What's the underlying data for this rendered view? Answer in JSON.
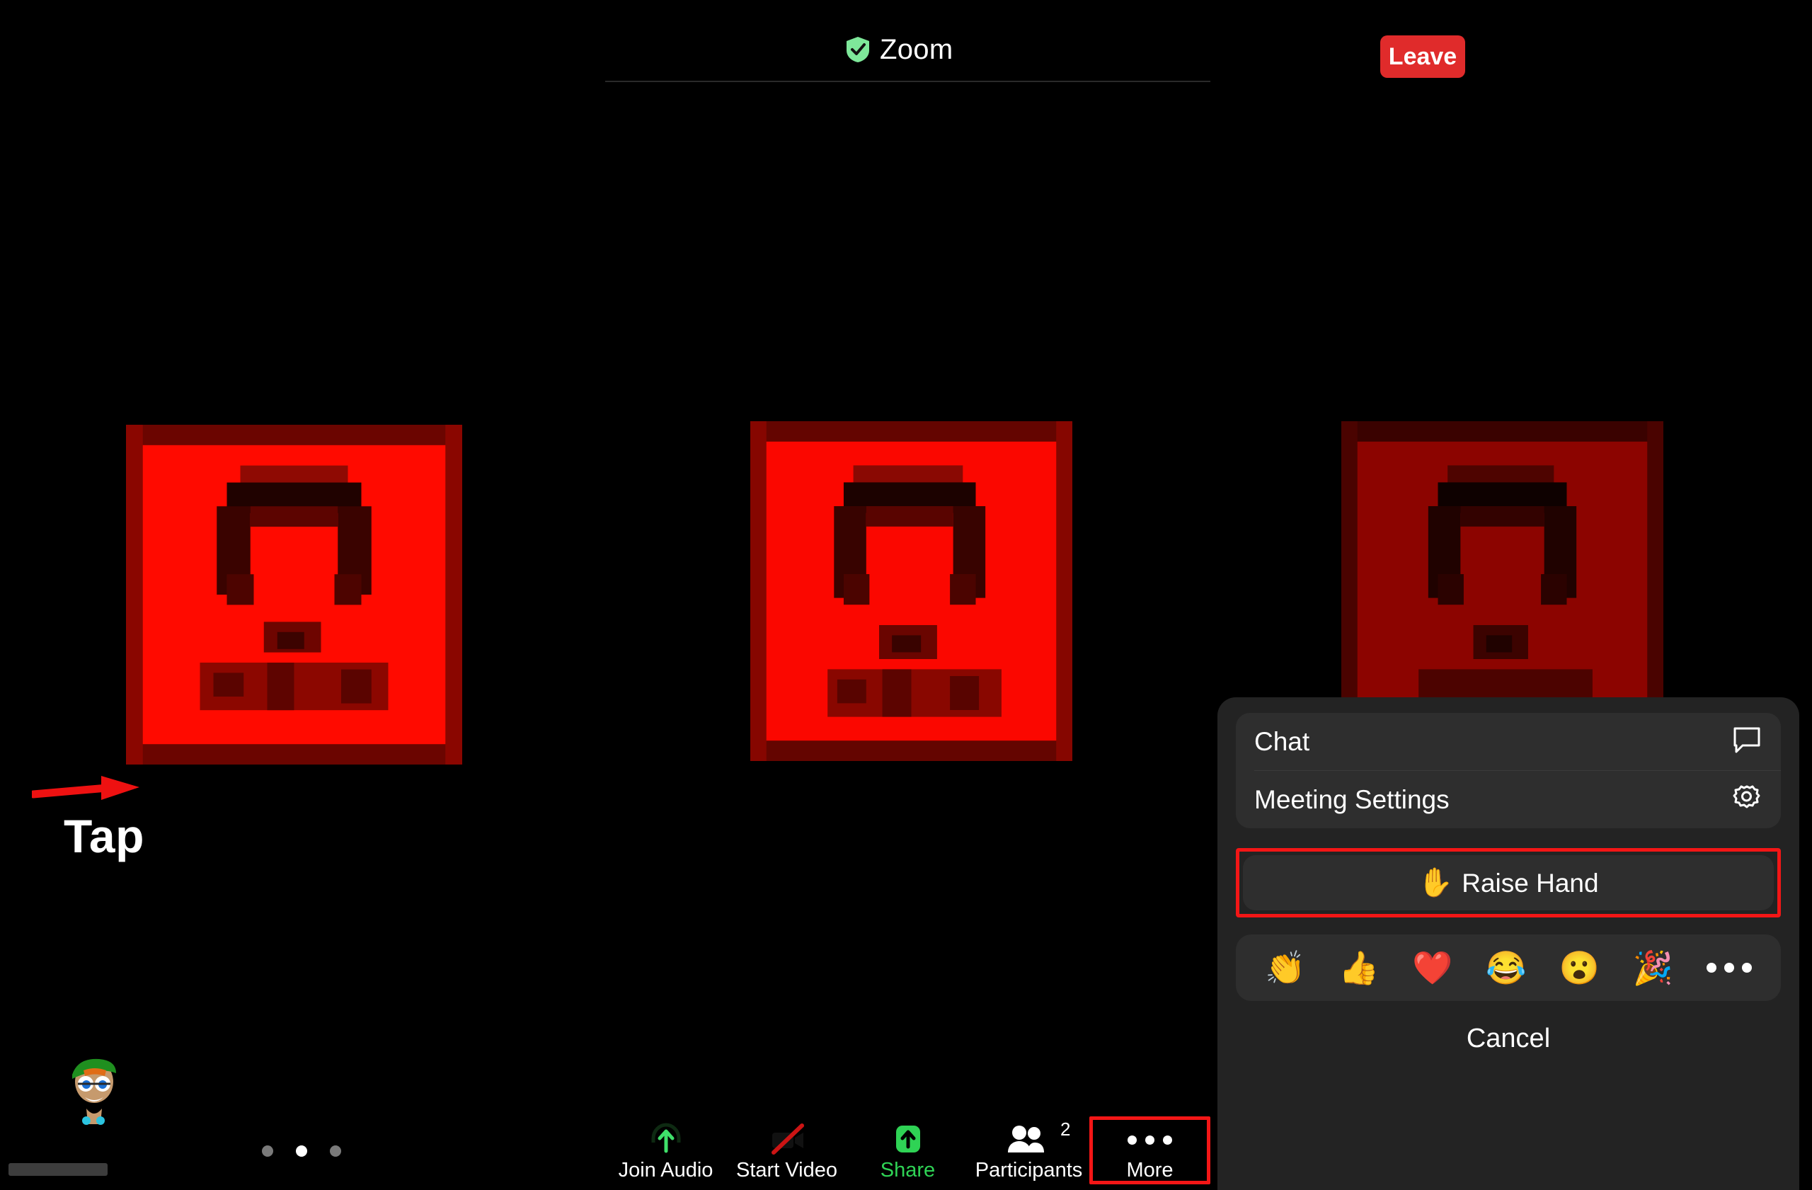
{
  "meeting": {
    "app_name": "Zoom",
    "security_icon": "shield-check-icon",
    "leave_label": "Leave"
  },
  "annotation": {
    "tap_label": "Tap",
    "arrow_icon": "red-arrow-right-icon",
    "more_highlight_color": "#f31616",
    "raise_hand_highlight_color": "#f31616"
  },
  "tiles": [
    {
      "name": "participant-video-tile-1",
      "state": "pixelated-red"
    },
    {
      "name": "participant-video-tile-2",
      "state": "pixelated-red"
    },
    {
      "name": "participant-video-tile-3",
      "state": "pixelated-red-dim"
    }
  ],
  "page_dots": {
    "count": 3,
    "active_index": 1
  },
  "toolbar": {
    "items": [
      {
        "label": "Join Audio",
        "icon": "headphone-up-arrow-icon",
        "accent": "#3fe06a",
        "highlighted": false,
        "badge": ""
      },
      {
        "label": "Start Video",
        "icon": "camera-off-icon",
        "accent": "#ffffff",
        "highlighted": false,
        "badge": ""
      },
      {
        "label": "Share",
        "icon": "share-up-arrow-icon",
        "accent": "#2fd355",
        "highlighted": false,
        "badge": ""
      },
      {
        "label": "Participants",
        "icon": "participants-icon",
        "accent": "#ffffff",
        "highlighted": false,
        "badge": "2"
      },
      {
        "label": "More",
        "icon": "ellipsis-icon",
        "accent": "#ffffff",
        "highlighted": true,
        "badge": ""
      }
    ]
  },
  "sheet": {
    "rows": [
      {
        "label": "Chat",
        "icon": "chat-bubble-icon"
      },
      {
        "label": "Meeting Settings",
        "icon": "gear-icon"
      }
    ],
    "raise_hand": {
      "label": "Raise Hand",
      "emoji": "✋",
      "icon": "raised-hand-icon"
    },
    "reactions": [
      {
        "name": "clap-emoji",
        "glyph": "👏"
      },
      {
        "name": "thumbs-up-emoji",
        "glyph": "👍"
      },
      {
        "name": "heart-emoji",
        "glyph": "❤️"
      },
      {
        "name": "joy-emoji",
        "glyph": "😂"
      },
      {
        "name": "open-mouth-emoji",
        "glyph": "😮"
      },
      {
        "name": "party-popper-emoji",
        "glyph": "🎉"
      }
    ],
    "more_reactions_icon": "ellipsis-icon",
    "cancel_label": "Cancel"
  }
}
